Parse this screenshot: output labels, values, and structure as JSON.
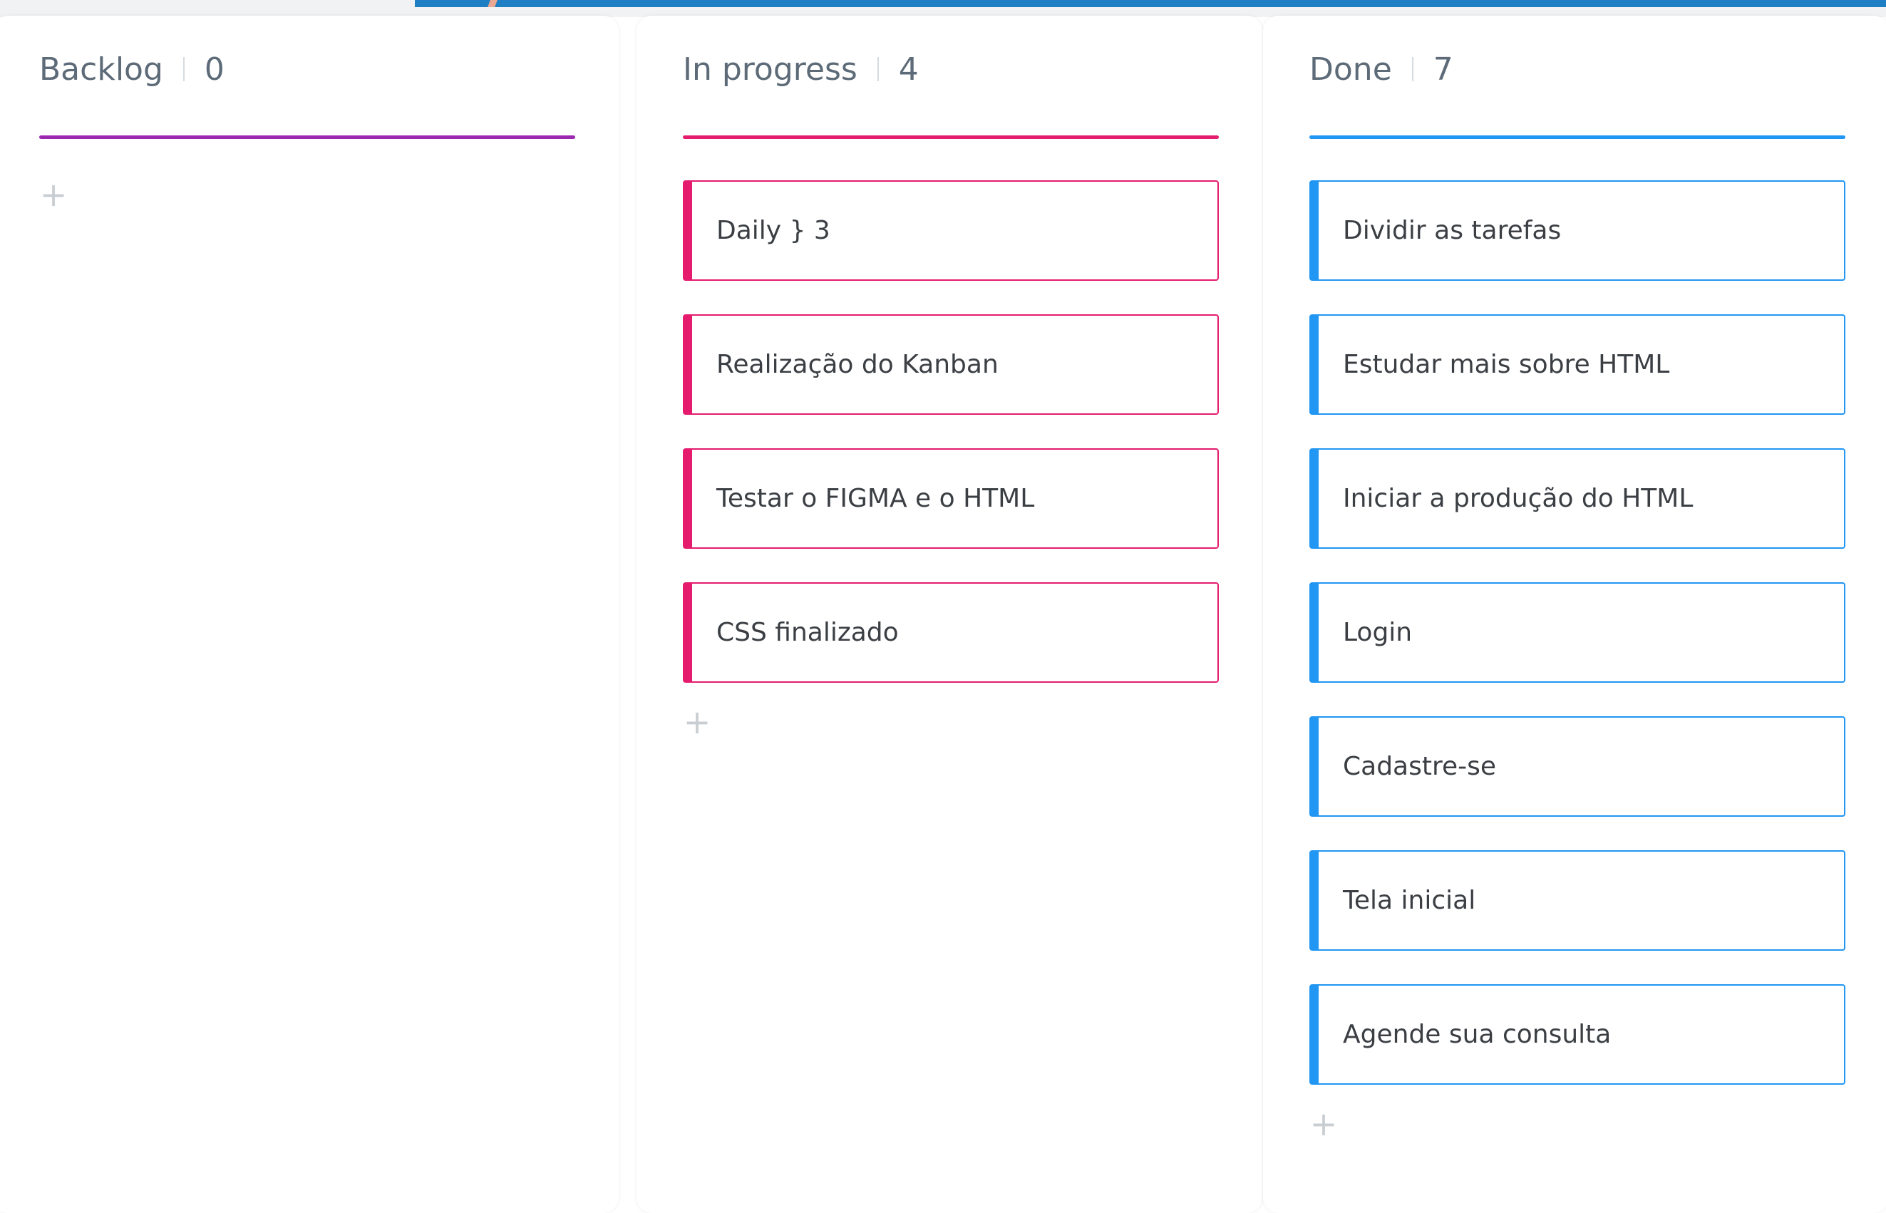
{
  "icons": {
    "add": "+"
  },
  "colors": {
    "backlog": "#9c27b0",
    "in_progress": "#e51b6e",
    "done": "#2196f3",
    "top_bar": "#1e7fc4"
  },
  "board": {
    "columns": [
      {
        "title": "Backlog",
        "count": "0",
        "cards": []
      },
      {
        "title": "In progress",
        "count": "4",
        "cards": [
          "Daily } 3",
          "Realização do Kanban",
          "Testar o FIGMA e o HTML",
          "CSS finalizado"
        ]
      },
      {
        "title": "Done",
        "count": "7",
        "cards": [
          "Dividir as tarefas",
          "Estudar mais sobre HTML",
          "Iniciar a produção do HTML",
          "Login",
          "Cadastre-se",
          "Tela inicial",
          "Agende sua consulta"
        ]
      }
    ]
  }
}
